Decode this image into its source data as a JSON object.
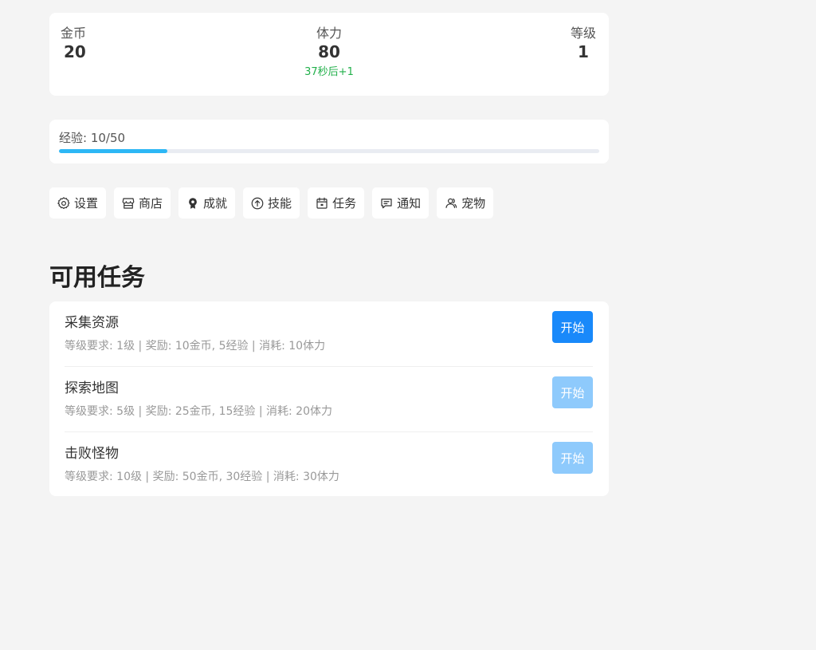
{
  "stats": {
    "coins": {
      "label": "金币",
      "value": "20"
    },
    "stamina": {
      "label": "体力",
      "value": "80",
      "regen": "37秒后+1"
    },
    "level": {
      "label": "等级",
      "value": "1"
    }
  },
  "experience": {
    "label": "经验: 10/50",
    "current": 10,
    "max": 50,
    "fraction": 0.2
  },
  "nav": [
    {
      "label": "设置",
      "icon": "gear-icon"
    },
    {
      "label": "商店",
      "icon": "store-icon"
    },
    {
      "label": "成就",
      "icon": "medal-icon"
    },
    {
      "label": "技能",
      "icon": "arrow-up-circle-icon"
    },
    {
      "label": "任务",
      "icon": "calendar-icon"
    },
    {
      "label": "通知",
      "icon": "message-icon"
    },
    {
      "label": "宠物",
      "icon": "users-icon"
    }
  ],
  "tasks_section": {
    "title": "可用任务",
    "tasks": [
      {
        "name": "采集资源",
        "meta": "等级要求: 1级 | 奖励: 10金币, 5经验 | 消耗: 10体力",
        "button": "开始",
        "enabled": true
      },
      {
        "name": "探索地图",
        "meta": "等级要求: 5级 | 奖励: 25金币, 15经验 | 消耗: 20体力",
        "button": "开始",
        "enabled": false
      },
      {
        "name": "击败怪物",
        "meta": "等级要求: 10级 | 奖励: 50金币, 30经验 | 消耗: 30体力",
        "button": "开始",
        "enabled": false
      }
    ]
  },
  "colors": {
    "primary": "#1989fa",
    "primary_disabled": "#8ecafc",
    "progress": "#2db7f5",
    "regen_text": "#22b04b"
  }
}
